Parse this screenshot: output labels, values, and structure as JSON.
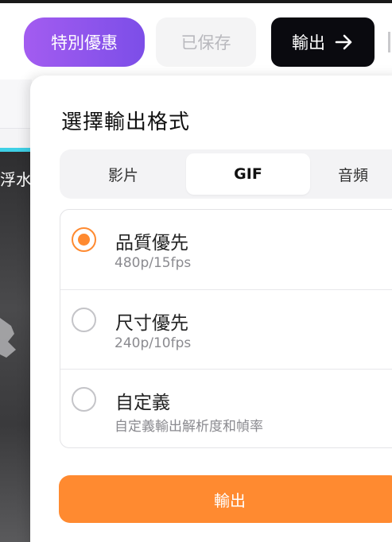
{
  "header": {
    "special_offer_label": "特別優惠",
    "saved_label": "已保存",
    "export_label": "輸出"
  },
  "background": {
    "overlay_text": "浮水"
  },
  "dialog": {
    "title": "選擇輸出格式",
    "tabs": [
      {
        "label": "影片",
        "selected": false
      },
      {
        "label": "GIF",
        "selected": true
      },
      {
        "label": "音頻",
        "selected": false
      }
    ],
    "options": [
      {
        "title": "品質優先",
        "subtitle": "480p/15fps",
        "selected": true
      },
      {
        "title": "尺寸優先",
        "subtitle": "240p/10fps",
        "selected": false
      },
      {
        "title": "自定義",
        "subtitle": "自定義輸出解析度和幀率",
        "selected": false
      }
    ],
    "export_button_label": "輸出"
  },
  "colors": {
    "accent_orange": "#ff8a30",
    "special_gradient_start": "#a35cf0",
    "special_gradient_end": "#7c4ee8",
    "export_top_bg": "#0a0a0f"
  }
}
